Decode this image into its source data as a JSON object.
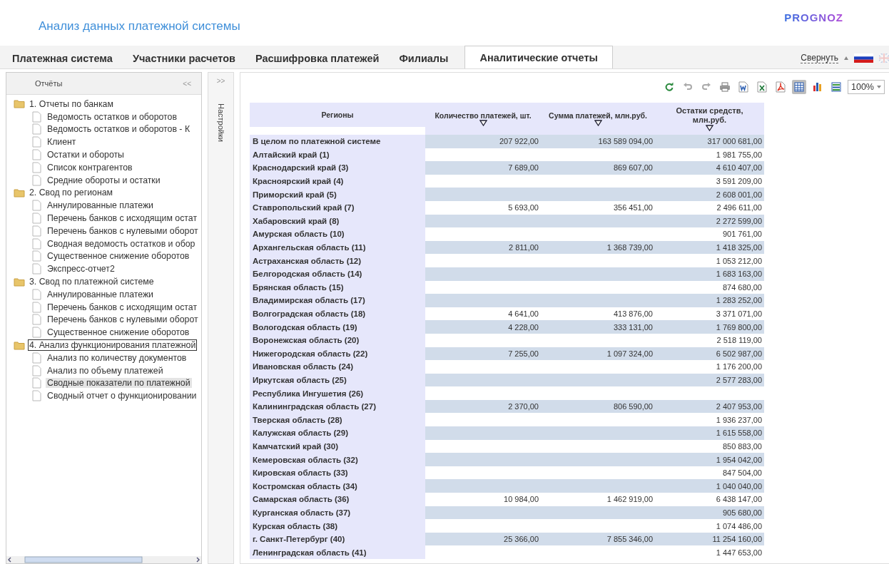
{
  "header": {
    "title": "Анализ данных платежной системы",
    "logo": "PROGNOZ"
  },
  "tabs": [
    {
      "label": "Платежная система",
      "selected": false
    },
    {
      "label": "Участники расчетов",
      "selected": false
    },
    {
      "label": "Расшифровка платежей",
      "selected": false
    },
    {
      "label": "Филиалы",
      "selected": false
    },
    {
      "label": "Аналитические отчеты",
      "selected": true
    }
  ],
  "collapse_link": "Свернуть",
  "reports_panel": {
    "title": "Отчёты",
    "collapse": "<<",
    "folders": [
      {
        "label": "1. Отчеты по банкам",
        "focused": false,
        "children": [
          {
            "label": "Ведомость остатков и оборотов",
            "selected": false
          },
          {
            "label": "Ведомость остатков и оборотов - К",
            "selected": false
          },
          {
            "label": "Клиент",
            "selected": false
          },
          {
            "label": "Остатки и обороты",
            "selected": false
          },
          {
            "label": "Список контрагентов",
            "selected": false
          },
          {
            "label": "Средние обороты и остатки",
            "selected": false
          }
        ]
      },
      {
        "label": "2. Свод по регионам",
        "focused": false,
        "children": [
          {
            "label": "Аннулированные платежи",
            "selected": false
          },
          {
            "label": "Перечень банков с исходящим остат",
            "selected": false
          },
          {
            "label": "Перечень банков с нулевыми оборот",
            "selected": false
          },
          {
            "label": "Сводная ведомость остатков и обор",
            "selected": false
          },
          {
            "label": "Существенное снижение оборотов",
            "selected": false
          },
          {
            "label": "Экспресс-отчет2",
            "selected": false
          }
        ]
      },
      {
        "label": "3. Свод по платежной системе",
        "focused": false,
        "children": [
          {
            "label": "Аннулированные платежи",
            "selected": false
          },
          {
            "label": "Перечень банков с исходящим остат",
            "selected": false
          },
          {
            "label": "Перечень банков с нулевыми оборот",
            "selected": false
          },
          {
            "label": "Существенное снижение оборотов",
            "selected": false
          }
        ]
      },
      {
        "label": "4. Анализ функционирования платежной",
        "focused": true,
        "children": [
          {
            "label": "Анализ по количеству документов",
            "selected": false
          },
          {
            "label": "Анализ по объему платежей",
            "selected": false
          },
          {
            "label": "Сводные показатели по платежной",
            "selected": true
          },
          {
            "label": "Сводный отчет о функционировании",
            "selected": false
          }
        ]
      }
    ]
  },
  "settings_strip": {
    "expand": ">>",
    "label": "Настройки"
  },
  "toolbar": {
    "tools": [
      {
        "kind": "refresh",
        "pressed": false
      },
      {
        "kind": "undo",
        "pressed": false
      },
      {
        "kind": "redo",
        "pressed": false
      },
      {
        "kind": "print",
        "pressed": false
      },
      {
        "kind": "word",
        "pressed": false
      },
      {
        "kind": "excel",
        "pressed": false
      },
      {
        "kind": "pdf",
        "pressed": false
      },
      {
        "kind": "table",
        "pressed": true
      },
      {
        "kind": "chart",
        "pressed": false
      },
      {
        "kind": "grid",
        "pressed": false
      }
    ],
    "zoom": "100%"
  },
  "table": {
    "columns": [
      "Регионы",
      "Количество платежей, шт.",
      "Сумма платежей, млн.руб.",
      "Остатки средств, млн.руб."
    ],
    "rows": [
      [
        "В целом по платежной системе",
        "207 922,00",
        "163 589 094,00",
        "317 000 681,00"
      ],
      [
        "Алтайский край (1)",
        "",
        "",
        "1 981 755,00"
      ],
      [
        "Краснодарский край (3)",
        "7 689,00",
        "869 607,00",
        "4 610 407,00"
      ],
      [
        "Красноярский край (4)",
        "",
        "",
        "3 591 209,00"
      ],
      [
        "Приморский край (5)",
        "",
        "",
        "2 608 001,00"
      ],
      [
        "Ставропольский край (7)",
        "5 693,00",
        "356 451,00",
        "2 496 611,00"
      ],
      [
        "Хабаровский край (8)",
        "",
        "",
        "2 272 599,00"
      ],
      [
        "Амурская область (10)",
        "",
        "",
        "901 761,00"
      ],
      [
        "Архангельская область (11)",
        "2 811,00",
        "1 368 739,00",
        "1 418 325,00"
      ],
      [
        "Астраханская область (12)",
        "",
        "",
        "1 053 212,00"
      ],
      [
        "Белгородская область (14)",
        "",
        "",
        "1 683 163,00"
      ],
      [
        "Брянская область (15)",
        "",
        "",
        "874 680,00"
      ],
      [
        "Владимирская область (17)",
        "",
        "",
        "1 283 252,00"
      ],
      [
        "Волгоградская область (18)",
        "4 641,00",
        "413 876,00",
        "3 371 071,00"
      ],
      [
        "Вологодская область (19)",
        "4 228,00",
        "333 131,00",
        "1 769 800,00"
      ],
      [
        "Воронежская область (20)",
        "",
        "",
        "2 518 119,00"
      ],
      [
        "Нижегородская область (22)",
        "7 255,00",
        "1 097 324,00",
        "6 502 987,00"
      ],
      [
        "Ивановская область (24)",
        "",
        "",
        "1 176 200,00"
      ],
      [
        "Иркутская область (25)",
        "",
        "",
        "2 577 283,00"
      ],
      [
        "Республика Ингушетия (26)",
        "",
        "",
        ""
      ],
      [
        "Калининградская область (27)",
        "2 370,00",
        "806 590,00",
        "2 407 953,00"
      ],
      [
        "Тверская область (28)",
        "",
        "",
        "1 936 237,00"
      ],
      [
        "Калужская область (29)",
        "",
        "",
        "1 615 558,00"
      ],
      [
        "Камчатский край (30)",
        "",
        "",
        "850 883,00"
      ],
      [
        "Кемеровская область (32)",
        "",
        "",
        "1 954 042,00"
      ],
      [
        "Кировская область (33)",
        "",
        "",
        "847 504,00"
      ],
      [
        "Костромская область (34)",
        "",
        "",
        "1 040 040,00"
      ],
      [
        "Самарская область (36)",
        "10 984,00",
        "1 462 919,00",
        "6 438 147,00"
      ],
      [
        "Курганская область (37)",
        "",
        "",
        "905 680,00"
      ],
      [
        "Курская область (38)",
        "",
        "",
        "1 074 486,00"
      ],
      [
        "г. Санкт-Петербург (40)",
        "25 366,00",
        "7 855 346,00",
        "11 254 160,00"
      ],
      [
        "Ленинградская область (41)",
        "",
        "",
        "1 447 653,00"
      ]
    ]
  }
}
